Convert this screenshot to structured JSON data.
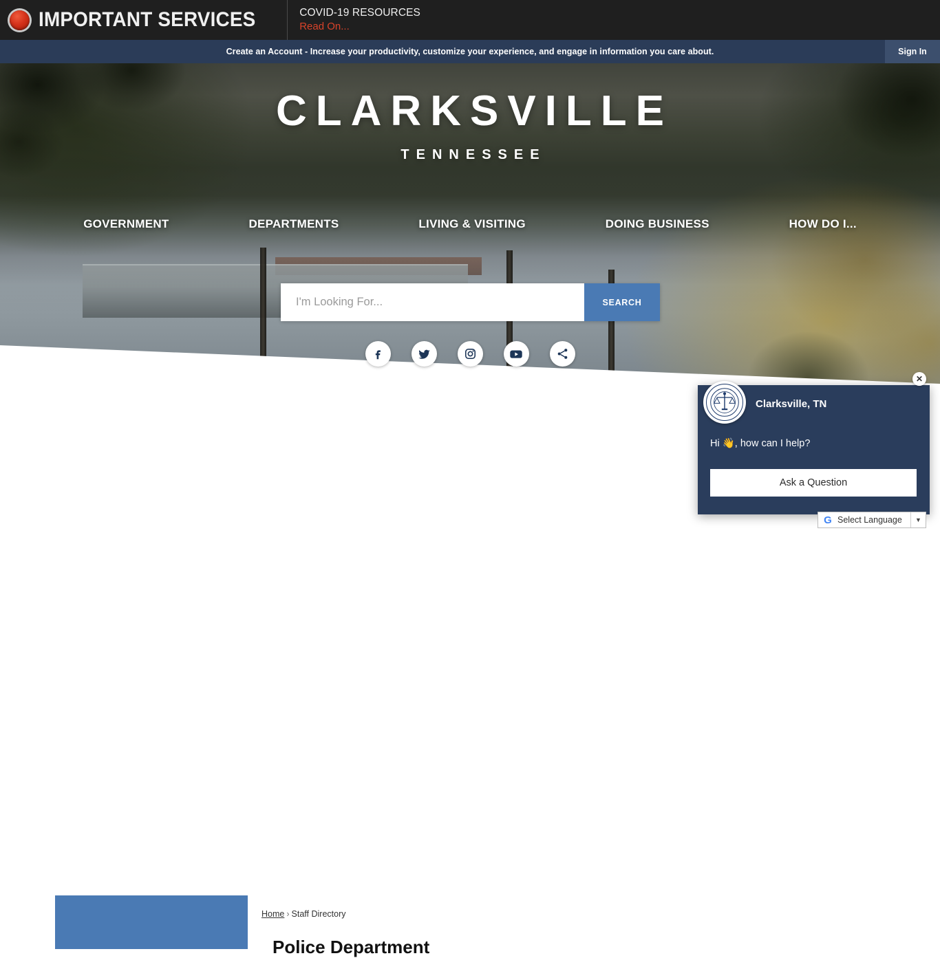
{
  "alert_bar": {
    "icon": "red-alert-dot-icon",
    "title": "IMPORTANT SERVICES",
    "headline": "COVID-19 RESOURCES",
    "read_on": "Read On..."
  },
  "account_bar": {
    "link_text": "Create an Account",
    "message": " - Increase your productivity, customize your experience, and engage in information you care about.",
    "sign_in": "Sign In",
    "bg_color": "#2b3c58",
    "signin_bg": "#3c4f6d"
  },
  "hero": {
    "city": "CLARKSVILLE",
    "state": "TENNESSEE",
    "nav": [
      {
        "label": "GOVERNMENT"
      },
      {
        "label": "DEPARTMENTS"
      },
      {
        "label": "LIVING & VISITING"
      },
      {
        "label": "DOING BUSINESS"
      },
      {
        "label": "HOW DO I..."
      }
    ],
    "search": {
      "placeholder": "I'm Looking For...",
      "value": "",
      "button": "SEARCH",
      "button_color": "#4a7ab4"
    },
    "social": [
      {
        "name": "facebook-icon"
      },
      {
        "name": "twitter-icon"
      },
      {
        "name": "instagram-icon"
      },
      {
        "name": "youtube-icon"
      },
      {
        "name": "share-icon"
      }
    ]
  },
  "chat_widget": {
    "seal_alt": "city-seal-icon",
    "title": "Clarksville, TN",
    "message": "Hi 👋, how can I help?",
    "button": "Ask a Question",
    "close": "✕",
    "bg_color": "#2a3d5c"
  },
  "translate": {
    "label": "Select Language",
    "arrow": "▼",
    "brand": "Google"
  },
  "main": {
    "breadcrumb": {
      "home": "Home",
      "separator": "›",
      "current": "Staff Directory"
    },
    "page_title": "Police Department",
    "side_block_color": "#4a7ab4"
  }
}
